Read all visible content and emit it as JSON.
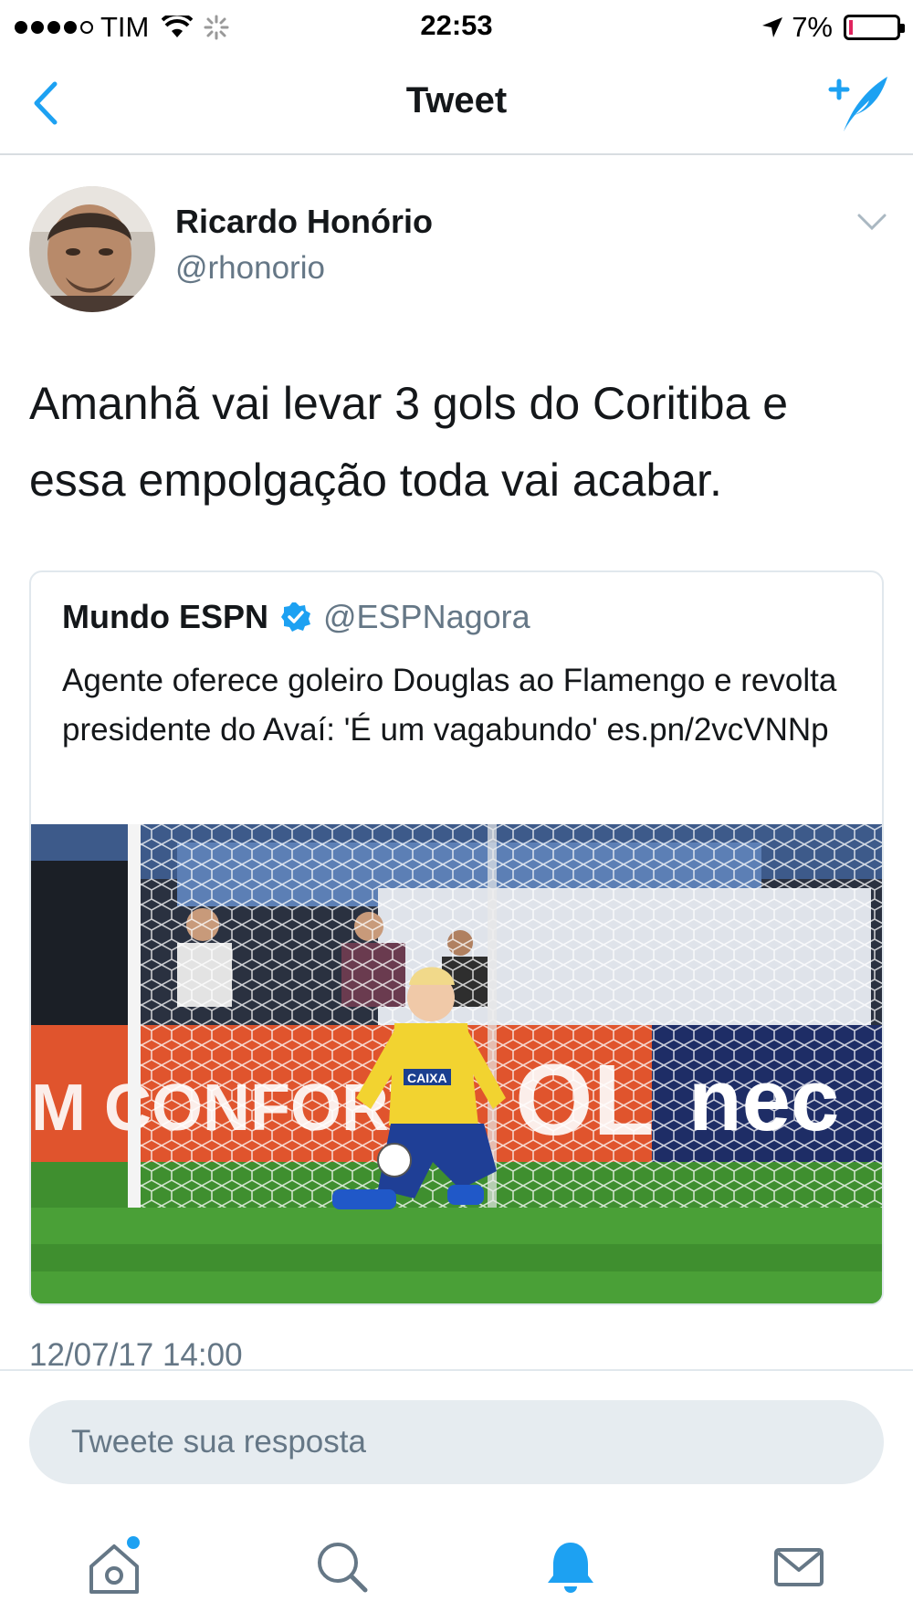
{
  "status_bar": {
    "carrier": "TIM",
    "time": "22:53",
    "battery_percent": "7%",
    "battery_level": 0.07,
    "signal_icon": "signal-dots-icon",
    "wifi_icon": "wifi-icon",
    "activity_icon": "activity-spinner-icon",
    "location_icon": "location-arrow-icon"
  },
  "nav": {
    "title": "Tweet",
    "back_icon": "chevron-left-icon",
    "compose_icon": "compose-tweet-icon",
    "accent_color": "#1da1f2"
  },
  "tweet": {
    "author_name": "Ricardo Honório",
    "author_handle": "@rhonorio",
    "text": "Amanhã vai levar 3 gols do Coritiba e essa empolgação toda vai acabar.",
    "timestamp": "12/07/17 14:00",
    "quoted": {
      "author_name": "Mundo ESPN",
      "verified": true,
      "author_handle": "@ESPNagora",
      "text": "Agente oferece goleiro Douglas ao Flamengo e revolta presidente do Avaí: 'É um vagabundo' es.pn/2vcVNNp",
      "media": {
        "shirt_sponsor": "CAIXA",
        "board_left": "M CONFORTO",
        "board_middle": "OL",
        "board_right": "nec"
      }
    }
  },
  "reply": {
    "placeholder": "Tweete sua resposta"
  },
  "tabbar": {
    "items": [
      "home-icon",
      "search-icon",
      "notifications-bell-icon",
      "messages-envelope-icon"
    ],
    "active_index": 2,
    "active_color": "#1da1f2",
    "inactive_color": "#657786"
  }
}
